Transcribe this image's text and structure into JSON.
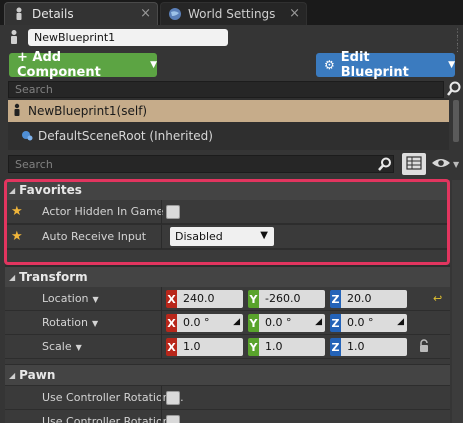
{
  "tabs": [
    {
      "label": "Details",
      "active": true,
      "close": "×"
    },
    {
      "label": "World Settings",
      "active": false,
      "close": "×"
    }
  ],
  "blueprint_name": "NewBlueprint1",
  "toolbar": {
    "add_component": "+ Add Component",
    "edit_blueprint": "Edit Blueprint"
  },
  "component_search": {
    "placeholder": "Search"
  },
  "components": [
    {
      "label": "NewBlueprint1(self)"
    },
    {
      "label": "DefaultSceneRoot (Inherited)"
    }
  ],
  "details_search": {
    "placeholder": "Search"
  },
  "categories": {
    "favorites": "Favorites",
    "transform": "Transform",
    "pawn": "Pawn"
  },
  "favorites": {
    "actor_hidden_label": "Actor Hidden In Game",
    "actor_hidden_checked": false,
    "auto_receive_label": "Auto Receive Input",
    "auto_receive_value": "Disabled"
  },
  "transform": {
    "location": {
      "label": "Location",
      "x": "240.0",
      "y": "-260.0",
      "z": "20.0"
    },
    "rotation": {
      "label": "Rotation",
      "x": "0.0 °",
      "y": "0.0 °",
      "z": "0.0 °"
    },
    "scale": {
      "label": "Scale",
      "x": "1.0",
      "y": "1.0",
      "z": "1.0"
    }
  },
  "pawn": {
    "row1": "Use Controller Rotation ...",
    "row2": "Use Controller Rotation ..."
  },
  "axis_labels": {
    "x": "X",
    "y": "Y",
    "z": "Z"
  },
  "colors": {
    "add_button": "#5ca443",
    "edit_button": "#3b7bbf",
    "selected_component": "#c6ac8a",
    "highlight": "#e2355f",
    "favorite_star": "#f0b53a"
  }
}
